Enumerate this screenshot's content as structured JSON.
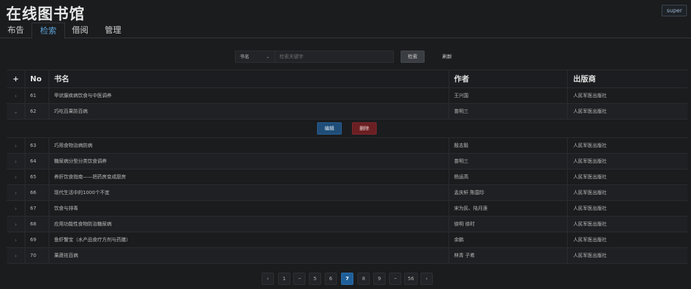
{
  "app": {
    "title": "在线图书馆",
    "user_label": "super"
  },
  "tabs": [
    {
      "label": "布告"
    },
    {
      "label": "检索"
    },
    {
      "label": "借阅"
    },
    {
      "label": "管理"
    }
  ],
  "search": {
    "field_selected": "书名",
    "placeholder": "检索关键字",
    "value": "",
    "search_label": "检索",
    "refresh_label": "刷新"
  },
  "table": {
    "headers": {
      "expand": "+",
      "no": "No",
      "title": "书名",
      "author": "作者",
      "publisher": "出版商"
    },
    "rows": [
      {
        "no": "61",
        "title": "甲状腺疾病饮食与中医调养",
        "author": "王兴国",
        "publisher": "人民军医出版社"
      },
      {
        "no": "62",
        "title": "巧吃百果防百病",
        "author": "苗明三",
        "publisher": "人民军医出版社",
        "expanded": true
      },
      {
        "no": "63",
        "title": "巧用食物治病防病",
        "author": "殷志毅",
        "publisher": "人民军医出版社"
      },
      {
        "no": "64",
        "title": "糖尿病分型分类饮食调养",
        "author": "苗明三",
        "publisher": "人民军医出版社"
      },
      {
        "no": "65",
        "title": "养肝饮食指南——把药房变成厨房",
        "author": "杨运高",
        "publisher": "人民军医出版社"
      },
      {
        "no": "66",
        "title": "现代生活中的1000个不宜",
        "author": "孟庆轩 陈国珍",
        "publisher": "人民军医出版社"
      },
      {
        "no": "67",
        "title": "饮食与排毒",
        "author": "宋为民、陆月莲",
        "publisher": "人民军医出版社"
      },
      {
        "no": "68",
        "title": "应用功能性食物防治糖尿病",
        "author": "徐明 徐时",
        "publisher": "人民军医出版社"
      },
      {
        "no": "69",
        "title": "鱼虾蟹宝（水产品食疗方剂与药膳）",
        "author": "余鹏",
        "publisher": "人民军医出版社"
      },
      {
        "no": "70",
        "title": "果蔬祛百病",
        "author": "林青 子希",
        "publisher": "人民军医出版社"
      }
    ],
    "actions": {
      "edit_label": "编辑",
      "delete_label": "删除"
    }
  },
  "pagination": {
    "prev": "‹",
    "next": "›",
    "pages": [
      "1",
      "···",
      "5",
      "6",
      "7",
      "8",
      "9",
      "···",
      "56"
    ],
    "current": "7"
  },
  "colors": {
    "accent": "#5a9fd4",
    "edit": "#1f4d78",
    "delete": "#6a1f22",
    "page_active": "#1f5f9a"
  },
  "icons": {
    "collapsed": "chevron-right-icon",
    "expanded": "chevron-down-icon",
    "select": "chevron-down-icon"
  }
}
